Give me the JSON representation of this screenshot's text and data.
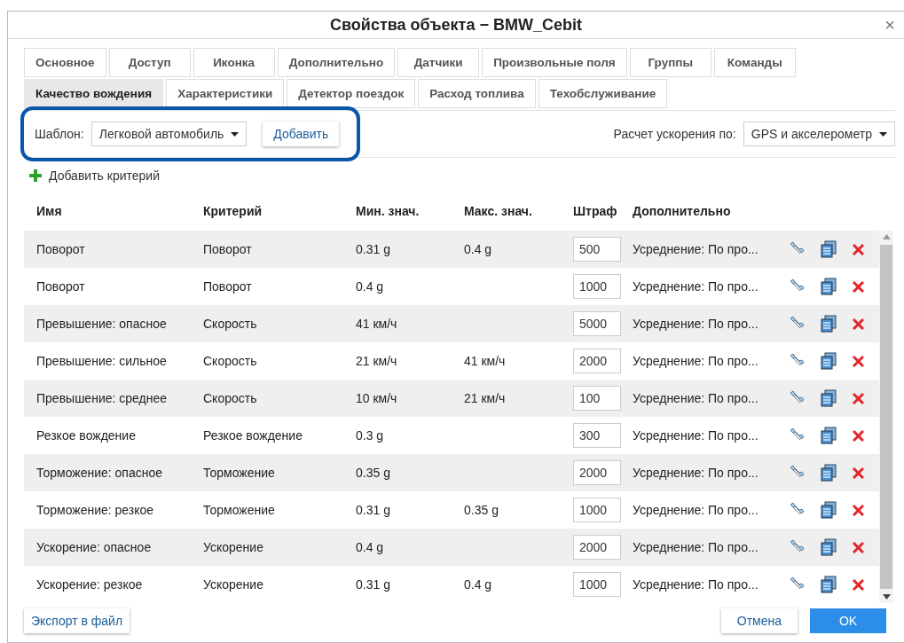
{
  "window": {
    "title": "Свойства объекта − BMW_Cebit",
    "close": "×"
  },
  "tab_rows": [
    [
      {
        "label": "Основное",
        "selected": false
      },
      {
        "label": "Доступ",
        "selected": false
      },
      {
        "label": "Иконка",
        "selected": false
      },
      {
        "label": "Дополнительно",
        "selected": false
      },
      {
        "label": "Датчики",
        "selected": false
      },
      {
        "label": "Произвольные поля",
        "selected": false
      },
      {
        "label": "Группы",
        "selected": false
      },
      {
        "label": "Команды",
        "selected": false
      }
    ],
    [
      {
        "label": "Качество вождения",
        "selected": true
      },
      {
        "label": "Характеристики",
        "selected": false
      },
      {
        "label": "Детектор поездок",
        "selected": false
      },
      {
        "label": "Расход топлива",
        "selected": false
      },
      {
        "label": "Техобслуживание",
        "selected": false
      }
    ]
  ],
  "template": {
    "label": "Шаблон:",
    "value": "Легковой автомобиль",
    "add_button": "Добавить"
  },
  "acceleration": {
    "label": "Расчет ускорения по:",
    "value": "GPS и акселерометр"
  },
  "add_criterion": "Добавить критерий",
  "table": {
    "columns": [
      "Имя",
      "Критерий",
      "Мин. знач.",
      "Макс. знач.",
      "Штраф",
      "Дополнительно"
    ],
    "rows": [
      {
        "name": "Поворот",
        "criterion": "Поворот",
        "min": "0.31 g",
        "max": "0.4 g",
        "penalty": "500",
        "extra": "Усреднение: По про..."
      },
      {
        "name": "Поворот",
        "criterion": "Поворот",
        "min": "0.4 g",
        "max": "",
        "penalty": "1000",
        "extra": "Усреднение: По про..."
      },
      {
        "name": "Превышение: опасное",
        "criterion": "Скорость",
        "min": "41 км/ч",
        "max": "",
        "penalty": "5000",
        "extra": "Усреднение: По про..."
      },
      {
        "name": "Превышение: сильное",
        "criterion": "Скорость",
        "min": "21 км/ч",
        "max": "41 км/ч",
        "penalty": "2000",
        "extra": "Усреднение: По про..."
      },
      {
        "name": "Превышение: среднее",
        "criterion": "Скорость",
        "min": "10 км/ч",
        "max": "21 км/ч",
        "penalty": "100",
        "extra": "Усреднение: По про..."
      },
      {
        "name": "Резкое вождение",
        "criterion": "Резкое вождение",
        "min": "0.3 g",
        "max": "",
        "penalty": "300",
        "extra": "Усреднение: По про..."
      },
      {
        "name": "Торможение: опасное",
        "criterion": "Торможение",
        "min": "0.35 g",
        "max": "",
        "penalty": "2000",
        "extra": "Усреднение: По про..."
      },
      {
        "name": "Торможение: резкое",
        "criterion": "Торможение",
        "min": "0.31 g",
        "max": "0.35 g",
        "penalty": "1000",
        "extra": "Усреднение: По про..."
      },
      {
        "name": "Ускорение: опасное",
        "criterion": "Ускорение",
        "min": "0.4 g",
        "max": "",
        "penalty": "2000",
        "extra": "Усреднение: По про..."
      },
      {
        "name": "Ускорение: резкое",
        "criterion": "Ускорение",
        "min": "0.31 g",
        "max": "0.4 g",
        "penalty": "1000",
        "extra": "Усреднение: По про..."
      }
    ]
  },
  "footer": {
    "export_button": "Экспорт в файл",
    "cancel_button": "Отмена",
    "ok_button": "OK"
  }
}
